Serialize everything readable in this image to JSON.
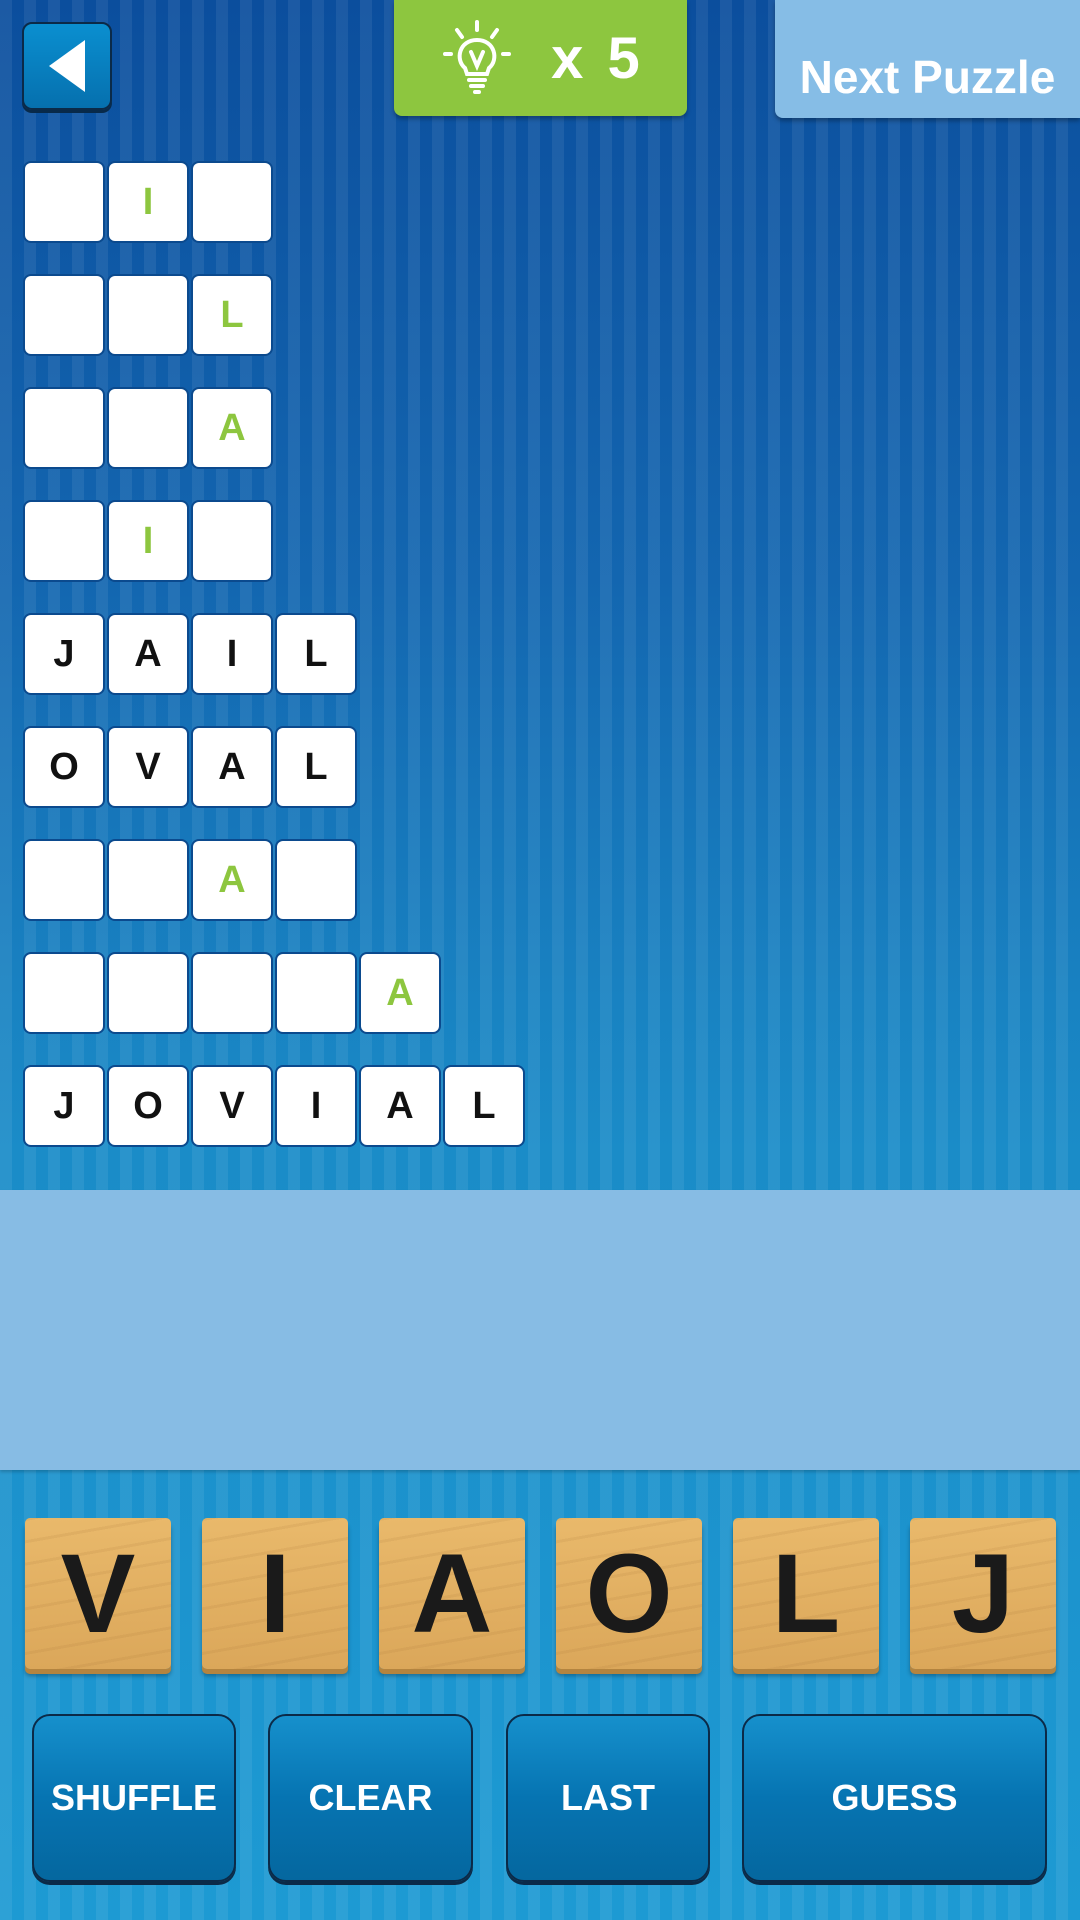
{
  "header": {
    "back_icon": "left-triangle-icon",
    "hint_icon": "lightbulb-icon",
    "hint_count": "x 5",
    "next_label": "Next Puzzle"
  },
  "colors": {
    "hint_green": "#8dc63f",
    "panel": "#87bce4",
    "tile_wood": "#e2b062"
  },
  "grid": [
    [
      {
        "l": ""
      },
      {
        "l": "I",
        "hint": true
      },
      {
        "l": ""
      }
    ],
    [
      {
        "l": ""
      },
      {
        "l": ""
      },
      {
        "l": "L",
        "hint": true
      }
    ],
    [
      {
        "l": ""
      },
      {
        "l": ""
      },
      {
        "l": "A",
        "hint": true
      }
    ],
    [
      {
        "l": ""
      },
      {
        "l": "I",
        "hint": true
      },
      {
        "l": ""
      }
    ],
    [
      {
        "l": "J"
      },
      {
        "l": "A"
      },
      {
        "l": "I"
      },
      {
        "l": "L"
      }
    ],
    [
      {
        "l": "O"
      },
      {
        "l": "V"
      },
      {
        "l": "A"
      },
      {
        "l": "L"
      }
    ],
    [
      {
        "l": ""
      },
      {
        "l": ""
      },
      {
        "l": "A",
        "hint": true
      },
      {
        "l": ""
      }
    ],
    [
      {
        "l": ""
      },
      {
        "l": ""
      },
      {
        "l": ""
      },
      {
        "l": ""
      },
      {
        "l": "A",
        "hint": true
      }
    ],
    [
      {
        "l": "J"
      },
      {
        "l": "O"
      },
      {
        "l": "V"
      },
      {
        "l": "I"
      },
      {
        "l": "A"
      },
      {
        "l": "L"
      }
    ]
  ],
  "letter_tiles": [
    "V",
    "I",
    "A",
    "O",
    "L",
    "J"
  ],
  "buttons": {
    "shuffle": "SHUFFLE",
    "clear": "CLEAR",
    "last": "LAST",
    "guess": "GUESS"
  }
}
